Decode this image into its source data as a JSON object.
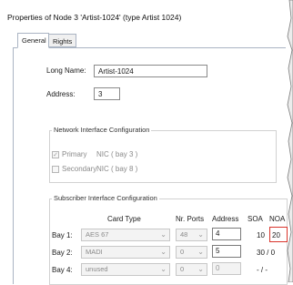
{
  "window": {
    "title": "Properties of Node 3 'Artist-1024' (type Artist 1024)"
  },
  "tabs": [
    {
      "label": "General"
    },
    {
      "label": "Rights"
    }
  ],
  "general": {
    "long_name_label": "Long Name:",
    "long_name_value": "Artist-1024",
    "address_label": "Address:",
    "address_value": "3"
  },
  "network": {
    "title": "Network Interface Configuration",
    "primary_label": "Primary",
    "primary_nic": "NIC ( bay 3 )",
    "primary_checked": true,
    "secondary_label": "Secondary",
    "secondary_nic": "NIC ( bay 8 )",
    "secondary_checked": false
  },
  "subscriber": {
    "title": "Subscriber Interface Configuration",
    "headers": {
      "card_type": "Card Type",
      "ports": "Nr. Ports",
      "address": "Address",
      "soa": "SOA",
      "noa": "NOA"
    },
    "rows": [
      {
        "bay": "Bay 1:",
        "card": "AES 67",
        "ports": "48",
        "address": "4",
        "soa": "10",
        "noa": "20"
      },
      {
        "bay": "Bay 2:",
        "card": "MADI",
        "ports": "0",
        "address": "5",
        "soa_noa": "30 / 0"
      },
      {
        "bay": "Bay 4:",
        "card": "unused",
        "ports": "0",
        "address": "0",
        "soa_noa": "- / -"
      }
    ]
  },
  "colors": {
    "highlight": "#d9342b",
    "tab_border": "#aab4c3"
  }
}
